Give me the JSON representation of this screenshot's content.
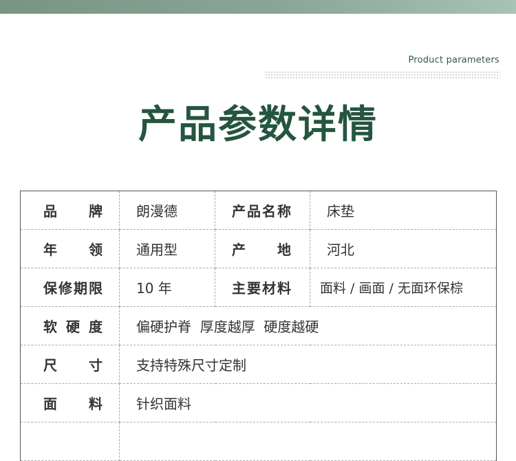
{
  "header": {
    "eyebrow": "Product parameters",
    "title": "产品参数详情"
  },
  "table": {
    "rows": [
      {
        "label": "品 牌",
        "value": "朗漫德",
        "label2": "产品名称",
        "value2": "床垫"
      },
      {
        "label": "年 领",
        "value": "通用型",
        "label2": "产 地",
        "value2": "河北"
      },
      {
        "label": "保修期限",
        "value": "10 年",
        "label2": "主要材料",
        "value2": "面料 / 画面 / 无面环保棕"
      },
      {
        "label": "软 硬 度",
        "value": "偏硬护脊  厚度越厚  硬度越硬"
      },
      {
        "label": "尺 寸",
        "value": "支持特殊尺寸定制"
      },
      {
        "label": "面 料",
        "value": "针织面料"
      },
      {
        "label": "",
        "value": ""
      }
    ]
  },
  "colors": {
    "accent": "#24553f",
    "band": "#8aa696"
  }
}
